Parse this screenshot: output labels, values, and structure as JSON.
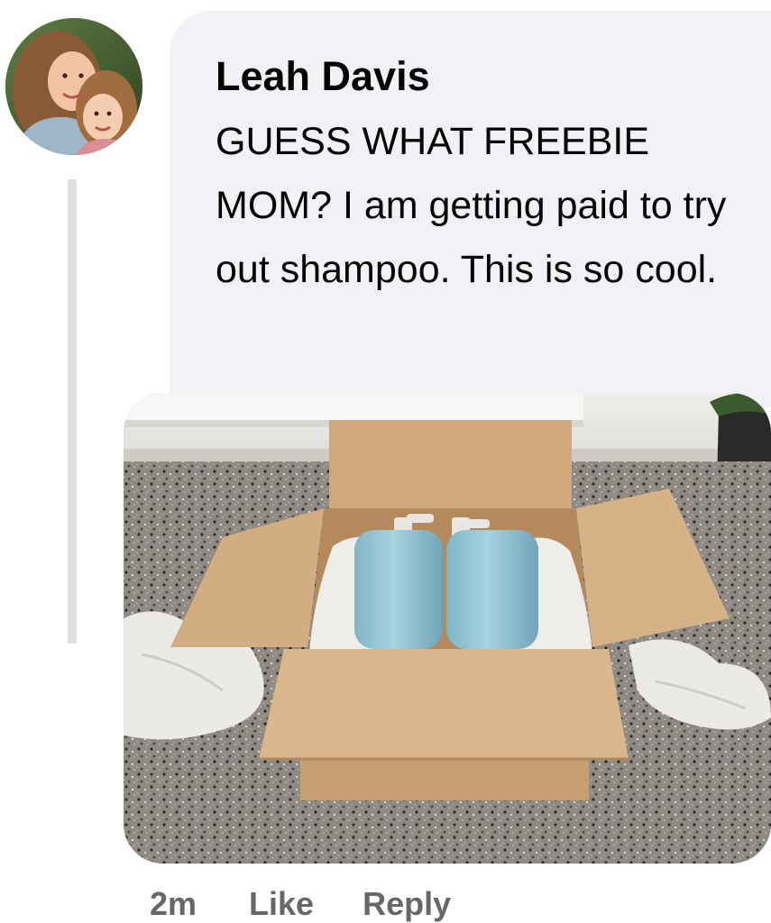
{
  "comment": {
    "author_name": "Leah Davis",
    "text": "GUESS WHAT FREEBIE MOM? I am getting paid to try out shampoo. This is so cool.",
    "timestamp": "2m",
    "like_label": "Like",
    "reply_label": "Reply"
  },
  "avatar": {
    "icon": "profile-photo"
  },
  "attachment": {
    "icon": "photo-box-with-shampoo-bottles"
  },
  "colors": {
    "bubble_background": "#f0f2f5",
    "text": "#050505",
    "meta_text": "#65676b",
    "thread_line": "#dcdee3"
  }
}
